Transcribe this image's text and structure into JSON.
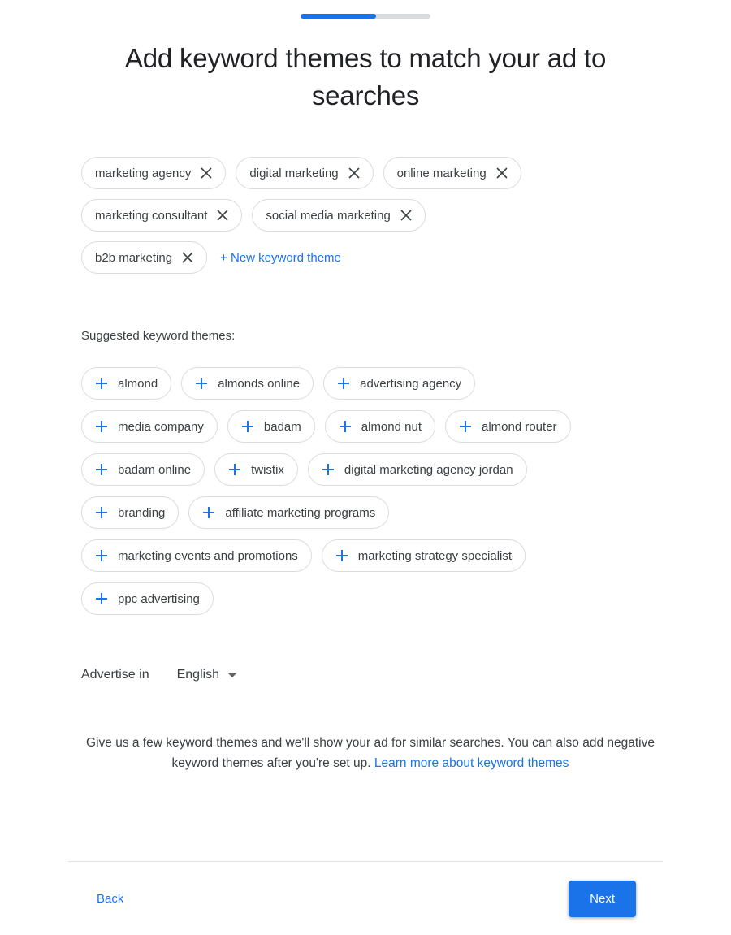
{
  "progress": {
    "percent": 58,
    "fill_color": "#1a73e8",
    "track_color": "#dadce0"
  },
  "header": {
    "title": "Add keyword themes to match your ad to searches"
  },
  "selected_themes": {
    "rows": [
      [
        {
          "label": "marketing agency",
          "remove_icon": "close-icon"
        },
        {
          "label": "digital marketing",
          "remove_icon": "close-icon"
        },
        {
          "label": "online marketing",
          "remove_icon": "close-icon"
        }
      ],
      [
        {
          "label": "marketing consultant",
          "remove_icon": "close-icon"
        },
        {
          "label": "social media marketing",
          "remove_icon": "close-icon"
        }
      ],
      [
        {
          "label": "b2b marketing",
          "remove_icon": "close-icon"
        }
      ]
    ],
    "new_theme_link": "+ New keyword theme"
  },
  "suggestions": {
    "label": "Suggested keyword themes:",
    "add_icon": "plus-icon",
    "rows": [
      [
        {
          "label": "almond"
        },
        {
          "label": "almonds online"
        },
        {
          "label": "advertising agency"
        }
      ],
      [
        {
          "label": "media company"
        },
        {
          "label": "badam"
        },
        {
          "label": "almond nut"
        },
        {
          "label": "almond router"
        }
      ],
      [
        {
          "label": "badam online"
        },
        {
          "label": "twistix"
        },
        {
          "label": "digital marketing agency jordan"
        }
      ],
      [
        {
          "label": "branding"
        },
        {
          "label": "affiliate marketing programs"
        }
      ],
      [
        {
          "label": "marketing events and promotions"
        },
        {
          "label": "marketing strategy specialist"
        }
      ],
      [
        {
          "label": "ppc advertising"
        }
      ]
    ]
  },
  "language": {
    "label": "Advertise in",
    "selected": "English",
    "caret_icon": "chevron-down-icon"
  },
  "help": {
    "text": "Give us a few keyword themes and we'll show your ad for similar searches. You can also add negative keyword themes after you're set up. ",
    "link_text": "Learn more about keyword themes"
  },
  "footer": {
    "back_label": "Back",
    "next_label": "Next",
    "next_color": "#1a73e8"
  }
}
